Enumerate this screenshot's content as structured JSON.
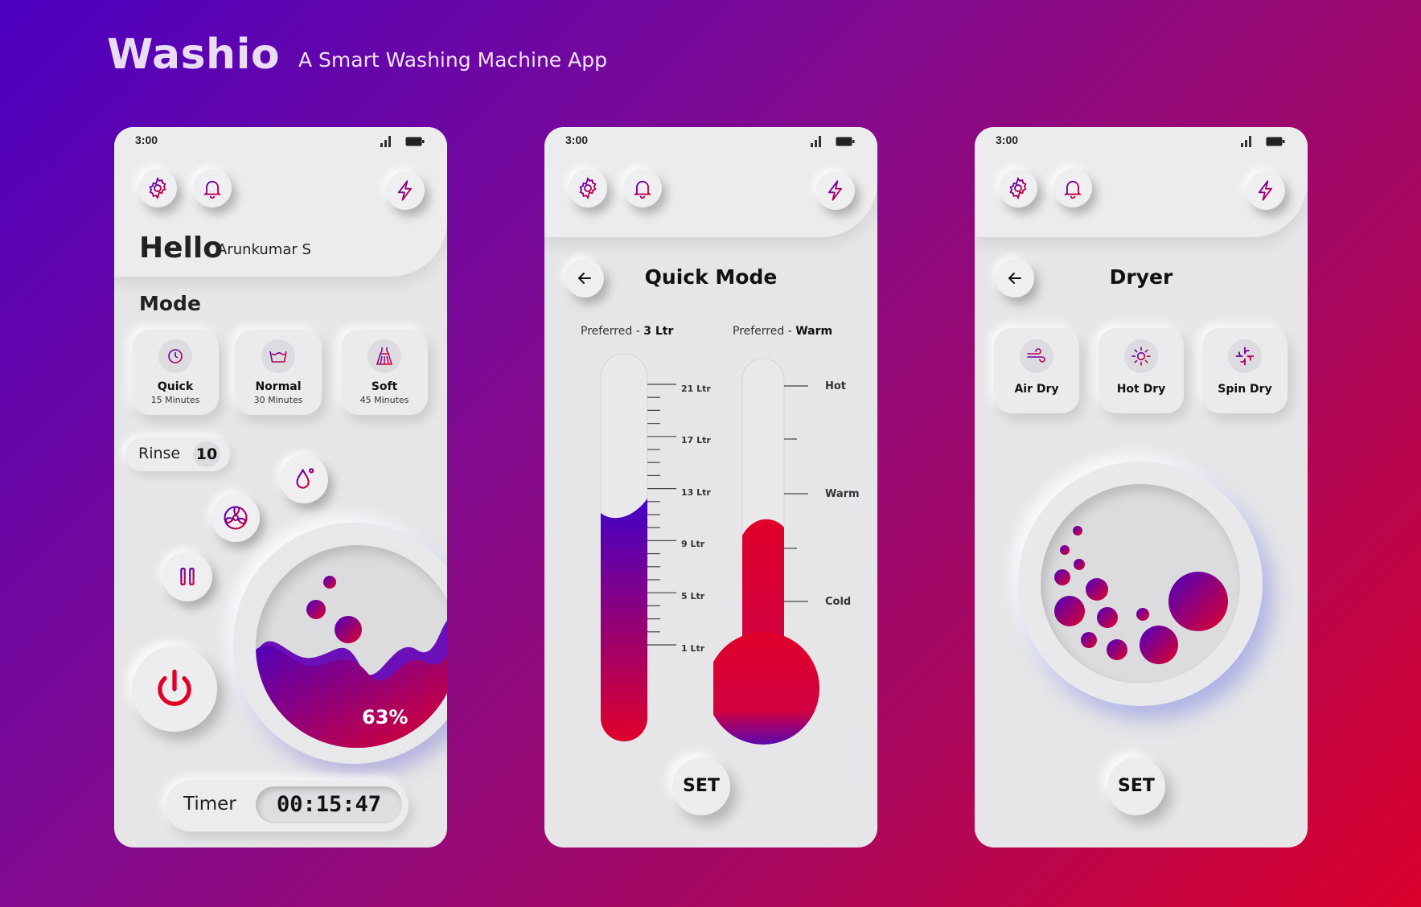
{
  "header": {
    "brand": "Washio",
    "tagline": "A Smart Washing Machine App"
  },
  "status_bar": {
    "time": "3:00"
  },
  "colors": {
    "accent_purple": "#4b00c0",
    "accent_red": "#e0002a",
    "surface": "#e6e6e8"
  },
  "screen_home": {
    "greeting": "Hello",
    "user_name": "Arunkumar S",
    "mode_title": "Mode",
    "modes": [
      {
        "label": "Quick",
        "duration": "15 Minutes",
        "icon": "clock-icon"
      },
      {
        "label": "Normal",
        "duration": "30 Minutes",
        "icon": "wash-tub-icon"
      },
      {
        "label": "Soft",
        "duration": "45 Minutes",
        "icon": "dress-icon"
      }
    ],
    "rinse_label": "Rinse",
    "rinse_value": "10",
    "drum_fill_percent": "63%",
    "timer_label": "Timer",
    "timer_value": "00:15:47"
  },
  "screen_quick": {
    "title": "Quick Mode",
    "water_pref_label": "Preferred - ",
    "water_pref_value": "3 Ltr",
    "temp_pref_label": "Preferred - ",
    "temp_pref_value": "Warm",
    "water_ticks": [
      "21 Ltr",
      "17 Ltr",
      "13 Ltr",
      "9 Ltr",
      "5 Ltr",
      "1 Ltr"
    ],
    "temp_ticks": [
      "Hot",
      "Warm",
      "Cold"
    ],
    "set_label": "SET"
  },
  "screen_dryer": {
    "title": "Dryer",
    "options": [
      {
        "label": "Air Dry",
        "icon": "wind-icon"
      },
      {
        "label": "Hot Dry",
        "icon": "sun-icon"
      },
      {
        "label": "Spin Dry",
        "icon": "fan-icon"
      }
    ],
    "set_label": "SET"
  }
}
